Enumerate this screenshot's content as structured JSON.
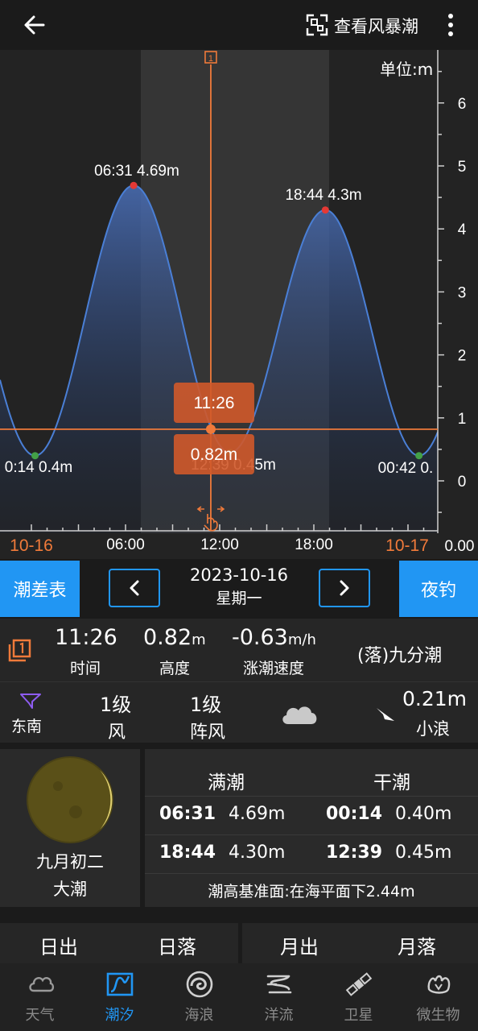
{
  "header": {
    "back_icon": "back-arrow-icon",
    "storm_label": "查看风暴潮",
    "storm_icon": "storm-tide-icon",
    "more_icon": "more-vert-icon"
  },
  "chart_data": {
    "type": "line",
    "unit_label": "单位:m",
    "y_ticks": [
      "6",
      "5",
      "4",
      "3",
      "2",
      "1",
      "0"
    ],
    "x_ticks": [
      "06:00",
      "12:00",
      "18:00"
    ],
    "date_labels": [
      "10-16",
      "10-17"
    ],
    "corner_label": "0.00",
    "ylim": [
      -0.6,
      6.6
    ],
    "series": [
      {
        "x": [
          "00:14",
          "06:31",
          "12:39",
          "18:44",
          "00:42"
        ],
        "y": [
          0.4,
          4.69,
          0.45,
          4.3,
          0.4
        ]
      }
    ],
    "annotations": [
      {
        "time": "06:31",
        "value": "4.69m",
        "kind": "high"
      },
      {
        "time": "18:44",
        "value": "4.3m",
        "kind": "high"
      },
      {
        "time": "0:14",
        "value": "0.4m",
        "kind": "low"
      },
      {
        "time": "12:39",
        "value": "0.45m",
        "kind": "low"
      },
      {
        "time": "00:42",
        "value": "0.",
        "kind": "low"
      }
    ],
    "cursor": {
      "time": "11:26",
      "value": "0.82m"
    },
    "colors": {
      "line": "#4a7fd6",
      "cursor": "#f07a3a",
      "high_dot": "#e53935",
      "low_dot": "#43a047"
    }
  },
  "datenav": {
    "left_button": "潮差表",
    "date": "2023-10-16",
    "weekday": "星期一",
    "right_button": "夜钓",
    "prev_icon": "chevron-left-icon",
    "next_icon": "chevron-right-icon"
  },
  "current": {
    "time": "11:26",
    "time_label": "时间",
    "height": "0.82",
    "height_unit": "m",
    "height_label": "高度",
    "speed": "-0.63",
    "speed_unit": "m/h",
    "speed_label": "涨潮速度",
    "phase": "(落)九分潮",
    "marker_icon": "marker-1-icon"
  },
  "weather": {
    "wind_dir": "东南",
    "wind_dir_icon": "wind-direction-icon",
    "wind_level": "1级",
    "wind_label": "风",
    "gust_level": "1级",
    "gust_label": "阵风",
    "weather_icon": "cloudy-icon",
    "wave_height": "0.21m",
    "wave_label": "小浪",
    "wave_icon": "wave-direction-icon"
  },
  "moon": {
    "lunar_date": "九月初二",
    "tide_type": "大潮"
  },
  "tide_table": {
    "high_header": "满潮",
    "low_header": "干潮",
    "rows": [
      {
        "high_time": "06:31",
        "high_value": "4.69m",
        "low_time": "00:14",
        "low_value": "0.40m"
      },
      {
        "high_time": "18:44",
        "high_value": "4.30m",
        "low_time": "12:39",
        "low_value": "0.45m"
      }
    ],
    "datum": "潮高基准面:在海平面下2.44m"
  },
  "sun_moon": {
    "sunrise": "日出",
    "sunset": "日落",
    "moonrise": "月出",
    "moonset": "月落"
  },
  "bottom_nav": [
    {
      "label": "天气",
      "icon": "cloud-icon"
    },
    {
      "label": "潮汐",
      "icon": "tide-icon"
    },
    {
      "label": "海浪",
      "icon": "wave-icon"
    },
    {
      "label": "洋流",
      "icon": "current-icon"
    },
    {
      "label": "卫星",
      "icon": "satellite-icon"
    },
    {
      "label": "微生物",
      "icon": "microbe-icon"
    }
  ]
}
